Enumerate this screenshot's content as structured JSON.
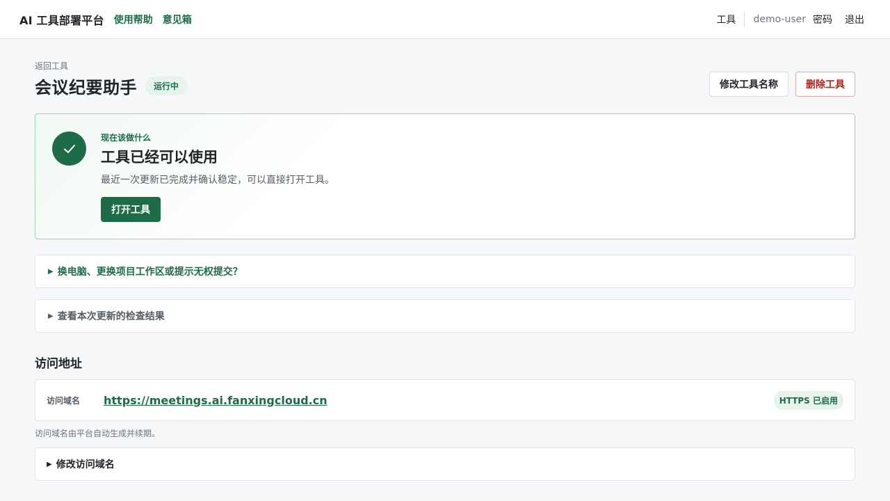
{
  "header": {
    "brand": "AI 工具部署平台",
    "nav": [
      "使用帮助",
      "意见箱"
    ],
    "tools_link": "工具",
    "username": "demo-user",
    "password_link": "密码",
    "logout_link": "退出"
  },
  "page": {
    "back_link": "返回工具",
    "title": "会议纪要助手",
    "status": "运行中",
    "rename_button": "修改工具名称",
    "delete_button": "删除工具"
  },
  "next_step": {
    "eyebrow": "现在该做什么",
    "title": "工具已经可以使用",
    "description": "最近一次更新已完成并确认稳定，可以直接打开工具。",
    "button": "打开工具"
  },
  "disclosures": {
    "workspace_help": "换电脑、更换项目工作区或提示无权提交？",
    "check_results": "查看本次更新的检查结果",
    "edit_domain": "修改访问域名"
  },
  "access": {
    "section_title": "访问地址",
    "domain_label": "访问域名",
    "url": "https://meetings.ai.fanxingcloud.cn",
    "https_badge": "HTTPS 已启用",
    "note": "访问域名由平台自动生成并续期。"
  },
  "colors": {
    "accent": "#1d6b47",
    "danger": "#b42318",
    "badge_bg": "#e7f4ec"
  },
  "icons": {
    "status_icon": "check-circle-icon",
    "disclosure_icon": "triangle-right-icon"
  }
}
